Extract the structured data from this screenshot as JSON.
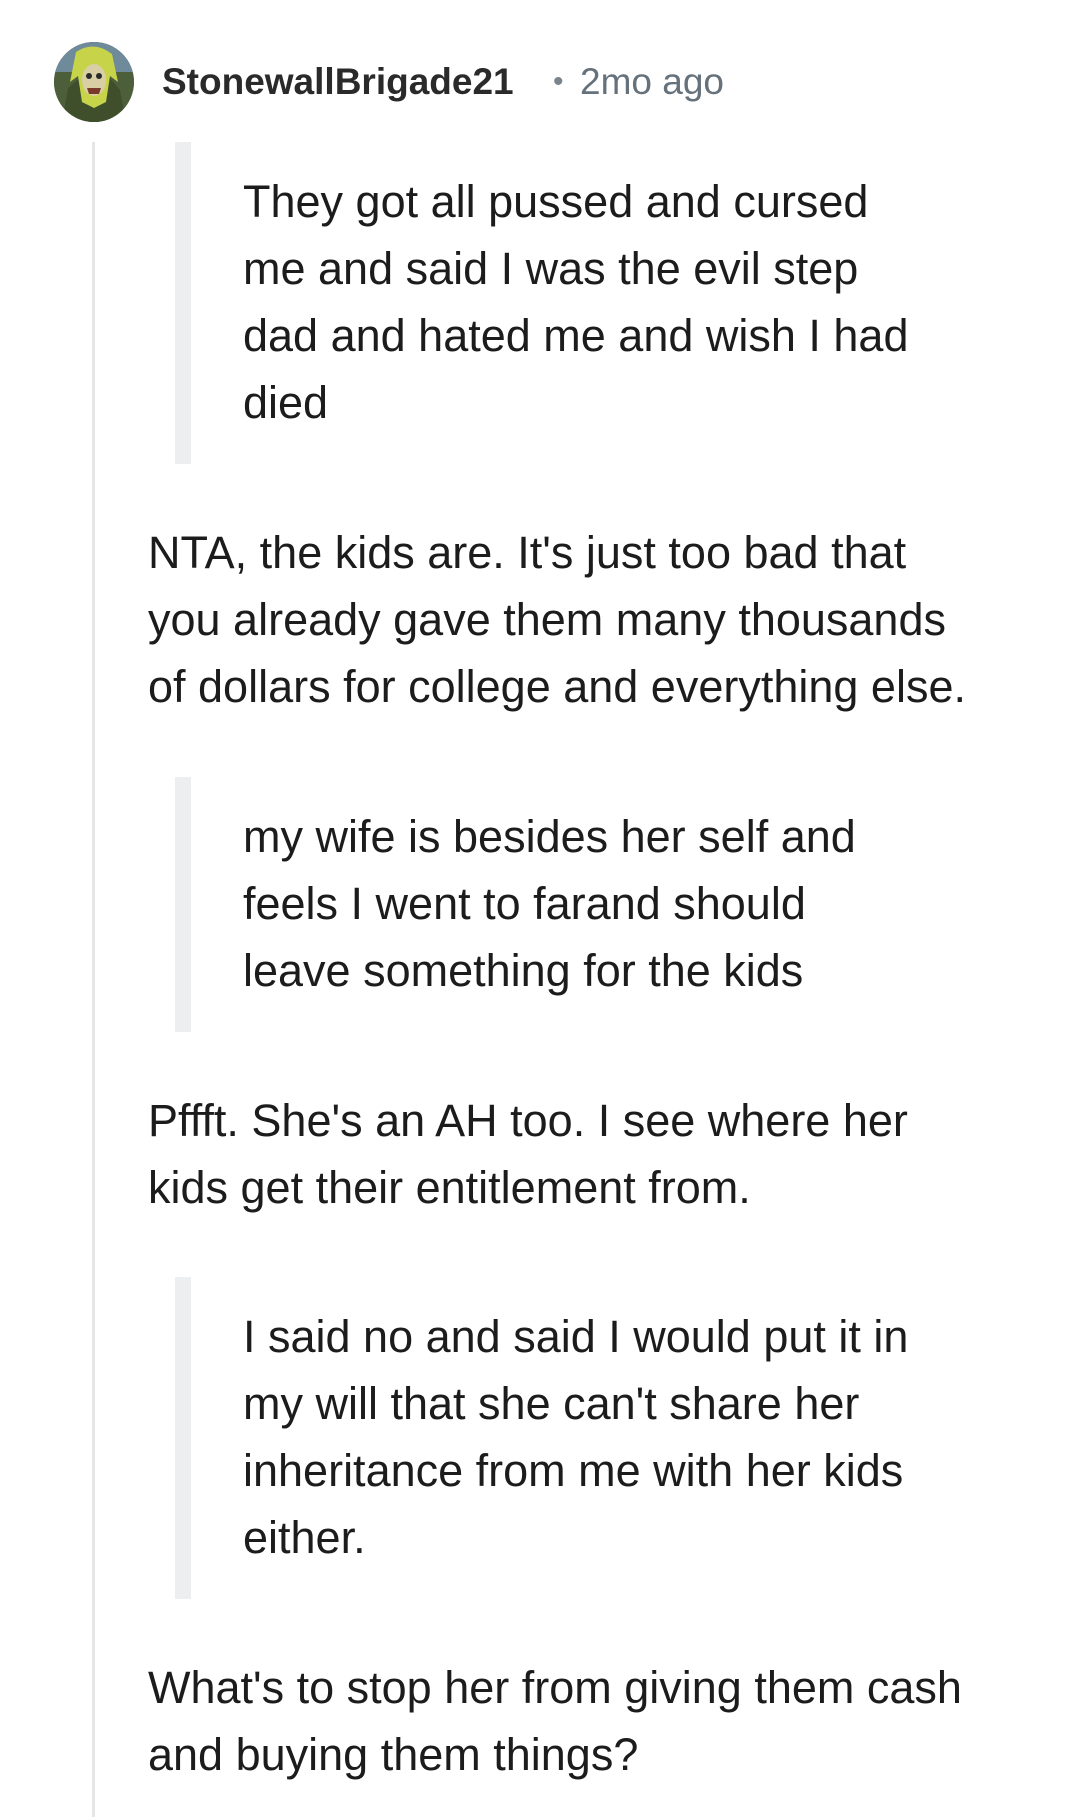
{
  "comment": {
    "author": "StonewallBrigade21",
    "separator": "•",
    "timestamp": "2mo ago",
    "avatar_icon": "iron-maiden-eddie-avatar",
    "blocks": [
      {
        "type": "quote",
        "lines": [
          "They got all pussed and cursed",
          "me and said I was the evil step",
          "dad and hated me and wish I had",
          "died"
        ]
      },
      {
        "type": "paragraph",
        "lines": [
          "NTA, the kids are. It's just too bad that",
          "you already gave them many thousands",
          "of dollars for college and everything else."
        ]
      },
      {
        "type": "quote",
        "lines": [
          "my wife is besides her self and",
          "feels I went to farand should",
          "leave something for the kids"
        ]
      },
      {
        "type": "paragraph",
        "lines": [
          "Pffft. She's an AH too. I see where her",
          "kids get their entitlement from."
        ]
      },
      {
        "type": "quote",
        "lines": [
          "I said no and said I would put it in",
          "my will that she can't share her",
          "inheritance from me with her kids",
          "either."
        ]
      },
      {
        "type": "paragraph",
        "lines": [
          "What's to stop her from giving them cash",
          "and buying them things?"
        ]
      }
    ]
  },
  "colors": {
    "quote_bar": "#eceeef",
    "thread_line": "#e4e6e8",
    "meta_text": "#65717b",
    "body_text": "#1c1c1c"
  }
}
